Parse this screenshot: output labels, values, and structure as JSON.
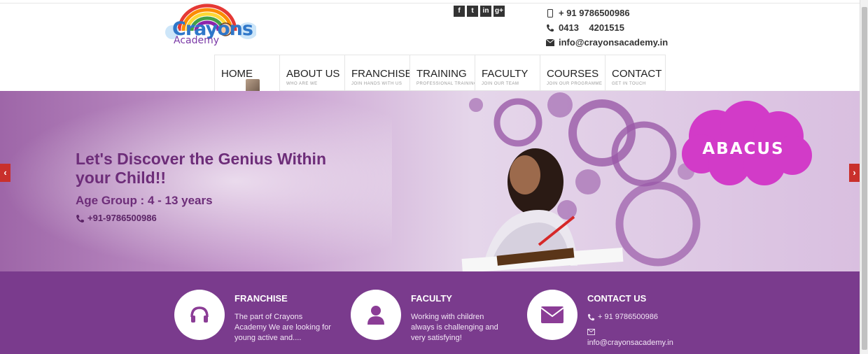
{
  "header": {
    "logo": {
      "main": "Crayons",
      "sub": "Academy"
    },
    "social": [
      {
        "icon": "facebook-icon",
        "glyph": "f"
      },
      {
        "icon": "twitter-icon",
        "glyph": "t"
      },
      {
        "icon": "linkedin-icon",
        "glyph": "in"
      },
      {
        "icon": "googleplus-icon",
        "glyph": "g+"
      }
    ],
    "contact": {
      "mobile": "+ 91 9786500986",
      "phone": "0413    4201515",
      "email": "info@crayonsacademy.in"
    }
  },
  "nav": {
    "items": [
      {
        "label": "HOME",
        "sub": ""
      },
      {
        "label": "ABOUT US",
        "sub": "WHO ARE WE"
      },
      {
        "label": "FRANCHISE",
        "sub": "JOIN HANDS WITH US"
      },
      {
        "label": "TRAINING",
        "sub": "PROFESSIONAL TRAINING"
      },
      {
        "label": "FACULTY",
        "sub": "JOIN OUR TEAM"
      },
      {
        "label": "COURSES",
        "sub": "JOIN OUR PROGRAMME"
      },
      {
        "label": "CONTACT",
        "sub": "GET IN TOUCH"
      }
    ]
  },
  "hero": {
    "title": "Let's Discover the Genius Within your Child!!",
    "age_group": "Age Group : 4 - 13 years",
    "phone": "+91-9786500986",
    "badge": "ABACUS",
    "prev": "‹",
    "next": "›"
  },
  "features": {
    "franchise": {
      "title": "FRANCHISE",
      "text": "The part of Crayons Academy We are looking for young active and...."
    },
    "faculty": {
      "title": "FACULTY",
      "text": "Working with children always is challenging and very satisfying!"
    },
    "contact": {
      "title": "CONTACT US",
      "phone": "+ 91 9786500986",
      "email": "info@crayonsacademy.in"
    }
  },
  "colors": {
    "brand_purple": "#7a3b8d",
    "hero_text": "#6d2d79",
    "badge_magenta": "#d23bc8",
    "arrow_red": "#c9302c"
  }
}
